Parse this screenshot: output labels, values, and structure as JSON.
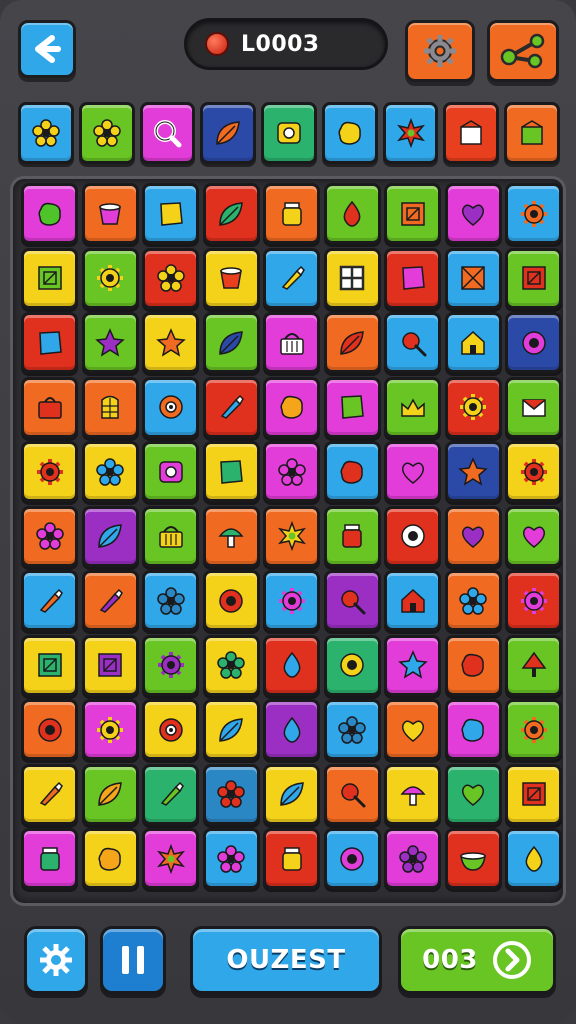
{
  "header": {
    "score": "L000З",
    "back_icon": "back-arrow-icon",
    "settings_icon": "gear-icon",
    "share_icon": "share-icon"
  },
  "strip": [
    {
      "bg": "#2fa7e8",
      "icon": "flower",
      "fg": "#f5d21a"
    },
    {
      "bg": "#68c524",
      "icon": "flower",
      "fg": "#f5d21a"
    },
    {
      "bg": "#e23cd9",
      "icon": "magnifier",
      "fg": "#ffffff"
    },
    {
      "bg": "#2b4aa8",
      "icon": "leaf",
      "fg": "#f06a21"
    },
    {
      "bg": "#2bb36e",
      "icon": "camera",
      "fg": "#f5d21a"
    },
    {
      "bg": "#2fa7e8",
      "icon": "blob",
      "fg": "#f5d21a"
    },
    {
      "bg": "#2fa7e8",
      "icon": "star-burst",
      "fg": "#e0301e"
    },
    {
      "bg": "#e8401e",
      "icon": "box",
      "fg": "#ffffff"
    },
    {
      "bg": "#f06a21",
      "icon": "box",
      "fg": "#68c524"
    }
  ],
  "board": [
    [
      {
        "bg": "#e23cd9",
        "icon": "blob",
        "fg": "#4fc42a"
      },
      {
        "bg": "#f06a21",
        "icon": "cup",
        "fg": "#e23cd9"
      },
      {
        "bg": "#2fa7e8",
        "icon": "square",
        "fg": "#f5d21a"
      },
      {
        "bg": "#e0301e",
        "icon": "leaf",
        "fg": "#2bb36e"
      },
      {
        "bg": "#f06a21",
        "icon": "jar",
        "fg": "#f5d21a"
      },
      {
        "bg": "#68c524",
        "icon": "drop",
        "fg": "#e0301e"
      },
      {
        "bg": "#68c524",
        "icon": "frame",
        "fg": "#f06a21"
      },
      {
        "bg": "#e23cd9",
        "icon": "heart",
        "fg": "#9b2fc4"
      },
      {
        "bg": "#2fa7e8",
        "icon": "gear",
        "fg": "#f06a21"
      }
    ],
    [
      {
        "bg": "#f5d21a",
        "icon": "frame",
        "fg": "#68c524"
      },
      {
        "bg": "#68c524",
        "icon": "gear",
        "fg": "#f5d21a"
      },
      {
        "bg": "#e0301e",
        "icon": "flower",
        "fg": "#f5d21a"
      },
      {
        "bg": "#f5d21a",
        "icon": "cup",
        "fg": "#e8401e"
      },
      {
        "bg": "#2fa7e8",
        "icon": "brush",
        "fg": "#f5d21a"
      },
      {
        "bg": "#f5d21a",
        "icon": "window",
        "fg": "#2a2a2a"
      },
      {
        "bg": "#e0301e",
        "icon": "square",
        "fg": "#e23cd9"
      },
      {
        "bg": "#2fa7e8",
        "icon": "cross-box",
        "fg": "#f06a21"
      },
      {
        "bg": "#68c524",
        "icon": "frame",
        "fg": "#e0301e"
      }
    ],
    [
      {
        "bg": "#e0301e",
        "icon": "square",
        "fg": "#2fa7e8"
      },
      {
        "bg": "#68c524",
        "icon": "star",
        "fg": "#9b2fc4"
      },
      {
        "bg": "#f5d21a",
        "icon": "star",
        "fg": "#f06a21"
      },
      {
        "bg": "#68c524",
        "icon": "leaf",
        "fg": "#2b4aa8"
      },
      {
        "bg": "#e23cd9",
        "icon": "basket",
        "fg": "#ffffff"
      },
      {
        "bg": "#f06a21",
        "icon": "leaf",
        "fg": "#e0301e"
      },
      {
        "bg": "#2fa7e8",
        "icon": "pin",
        "fg": "#e0301e"
      },
      {
        "bg": "#2fa7e8",
        "icon": "house",
        "fg": "#f5d21a"
      },
      {
        "bg": "#2b4aa8",
        "icon": "ring",
        "fg": "#e23cd9"
      }
    ],
    [
      {
        "bg": "#f06a21",
        "icon": "bag",
        "fg": "#e0301e"
      },
      {
        "bg": "#f06a21",
        "icon": "door",
        "fg": "#f5d21a"
      },
      {
        "bg": "#2fa7e8",
        "icon": "eye",
        "fg": "#f06a21"
      },
      {
        "bg": "#e0301e",
        "icon": "brush",
        "fg": "#2fa7e8"
      },
      {
        "bg": "#e23cd9",
        "icon": "blob",
        "fg": "#f5a51a"
      },
      {
        "bg": "#e23cd9",
        "icon": "square",
        "fg": "#68c524"
      },
      {
        "bg": "#68c524",
        "icon": "crown",
        "fg": "#f5d21a"
      },
      {
        "bg": "#e0301e",
        "icon": "gear",
        "fg": "#f5d21a"
      },
      {
        "bg": "#68c524",
        "icon": "envelope",
        "fg": "#e0301e"
      }
    ],
    [
      {
        "bg": "#f5d21a",
        "icon": "gear",
        "fg": "#e0301e"
      },
      {
        "bg": "#f5d21a",
        "icon": "flower",
        "fg": "#2fa7e8"
      },
      {
        "bg": "#68c524",
        "icon": "camera",
        "fg": "#e23cd9"
      },
      {
        "bg": "#f5d21a",
        "icon": "square",
        "fg": "#2bb36e"
      },
      {
        "bg": "#e23cd9",
        "icon": "flower",
        "fg": "#e23cd9"
      },
      {
        "bg": "#2fa7e8",
        "icon": "blob",
        "fg": "#e0301e"
      },
      {
        "bg": "#e23cd9",
        "icon": "heart",
        "fg": "#e23cd9"
      },
      {
        "bg": "#2b4aa8",
        "icon": "star",
        "fg": "#f06a21"
      },
      {
        "bg": "#f5d21a",
        "icon": "gear",
        "fg": "#e0301e"
      }
    ],
    [
      {
        "bg": "#f06a21",
        "icon": "flower",
        "fg": "#e23cd9"
      },
      {
        "bg": "#9b2fc4",
        "icon": "leaf",
        "fg": "#2fa7e8"
      },
      {
        "bg": "#68c524",
        "icon": "basket",
        "fg": "#f5d21a"
      },
      {
        "bg": "#f06a21",
        "icon": "mushroom",
        "fg": "#2bb36e"
      },
      {
        "bg": "#f06a21",
        "icon": "star-burst",
        "fg": "#f5d21a"
      },
      {
        "bg": "#68c524",
        "icon": "jar",
        "fg": "#e0301e"
      },
      {
        "bg": "#e0301e",
        "icon": "ring",
        "fg": "#ffffff"
      },
      {
        "bg": "#f06a21",
        "icon": "heart",
        "fg": "#9b2fc4"
      },
      {
        "bg": "#68c524",
        "icon": "heart",
        "fg": "#e23cd9"
      }
    ],
    [
      {
        "bg": "#2fa7e8",
        "icon": "brush",
        "fg": "#f06a21"
      },
      {
        "bg": "#f06a21",
        "icon": "brush",
        "fg": "#9b2fc4"
      },
      {
        "bg": "#2fa7e8",
        "icon": "flower",
        "fg": "#2b86c4"
      },
      {
        "bg": "#f5d21a",
        "icon": "ring",
        "fg": "#e0301e"
      },
      {
        "bg": "#2fa7e8",
        "icon": "gear",
        "fg": "#e23cd9"
      },
      {
        "bg": "#9b2fc4",
        "icon": "pin",
        "fg": "#e0301e"
      },
      {
        "bg": "#2fa7e8",
        "icon": "house",
        "fg": "#e0301e"
      },
      {
        "bg": "#f06a21",
        "icon": "flower",
        "fg": "#2fa7e8"
      },
      {
        "bg": "#e0301e",
        "icon": "gear",
        "fg": "#e23cd9"
      }
    ],
    [
      {
        "bg": "#f5d21a",
        "icon": "frame",
        "fg": "#2bb36e"
      },
      {
        "bg": "#f5d21a",
        "icon": "frame",
        "fg": "#9b2fc4"
      },
      {
        "bg": "#68c524",
        "icon": "gear",
        "fg": "#9b2fc4"
      },
      {
        "bg": "#f5d21a",
        "icon": "flower",
        "fg": "#2bb36e"
      },
      {
        "bg": "#e0301e",
        "icon": "drop",
        "fg": "#2fa7e8"
      },
      {
        "bg": "#2bb36e",
        "icon": "ring",
        "fg": "#f5d21a"
      },
      {
        "bg": "#e23cd9",
        "icon": "star",
        "fg": "#2fa7e8"
      },
      {
        "bg": "#f06a21",
        "icon": "blob",
        "fg": "#e0301e"
      },
      {
        "bg": "#68c524",
        "icon": "tree",
        "fg": "#e0301e"
      }
    ],
    [
      {
        "bg": "#f06a21",
        "icon": "ring",
        "fg": "#e0301e"
      },
      {
        "bg": "#e23cd9",
        "icon": "gear",
        "fg": "#f5d21a"
      },
      {
        "bg": "#f5d21a",
        "icon": "eye",
        "fg": "#e0301e"
      },
      {
        "bg": "#f5d21a",
        "icon": "leaf",
        "fg": "#2fa7e8"
      },
      {
        "bg": "#9b2fc4",
        "icon": "drop",
        "fg": "#2fa7e8"
      },
      {
        "bg": "#2fa7e8",
        "icon": "flower",
        "fg": "#2b86c4"
      },
      {
        "bg": "#f06a21",
        "icon": "heart",
        "fg": "#f5d21a"
      },
      {
        "bg": "#e23cd9",
        "icon": "blob",
        "fg": "#2fa7e8"
      },
      {
        "bg": "#68c524",
        "icon": "gear",
        "fg": "#f06a21"
      }
    ],
    [
      {
        "bg": "#f5d21a",
        "icon": "brush",
        "fg": "#f06a21"
      },
      {
        "bg": "#68c524",
        "icon": "leaf",
        "fg": "#f5a51a"
      },
      {
        "bg": "#2bb36e",
        "icon": "brush",
        "fg": "#68c524"
      },
      {
        "bg": "#2b86c4",
        "icon": "flower",
        "fg": "#e0301e"
      },
      {
        "bg": "#f5d21a",
        "icon": "leaf",
        "fg": "#2fa7e8"
      },
      {
        "bg": "#f06a21",
        "icon": "pin",
        "fg": "#e0301e"
      },
      {
        "bg": "#f5d21a",
        "icon": "mushroom",
        "fg": "#e23cd9"
      },
      {
        "bg": "#2bb36e",
        "icon": "heart",
        "fg": "#68c524"
      },
      {
        "bg": "#f5d21a",
        "icon": "frame",
        "fg": "#e0301e"
      }
    ],
    [
      {
        "bg": "#e23cd9",
        "icon": "jar",
        "fg": "#2bb36e"
      },
      {
        "bg": "#f5d21a",
        "icon": "blob",
        "fg": "#f5a51a"
      },
      {
        "bg": "#e23cd9",
        "icon": "star-burst",
        "fg": "#f06a21"
      },
      {
        "bg": "#2fa7e8",
        "icon": "flower",
        "fg": "#e23cd9"
      },
      {
        "bg": "#e0301e",
        "icon": "jar",
        "fg": "#f5d21a"
      },
      {
        "bg": "#2fa7e8",
        "icon": "ring",
        "fg": "#e23cd9"
      },
      {
        "bg": "#e23cd9",
        "icon": "flower",
        "fg": "#9b2fc4"
      },
      {
        "bg": "#e0301e",
        "icon": "bowl",
        "fg": "#68c524"
      },
      {
        "bg": "#2fa7e8",
        "icon": "drop",
        "fg": "#f5d21a"
      }
    ]
  ],
  "footer": {
    "restart_icon": "restart-gear-icon",
    "pause_icon": "pause-icon",
    "mode_label": "OUZEST",
    "next_label": "003",
    "next_icon": "chevron-right-icon"
  }
}
